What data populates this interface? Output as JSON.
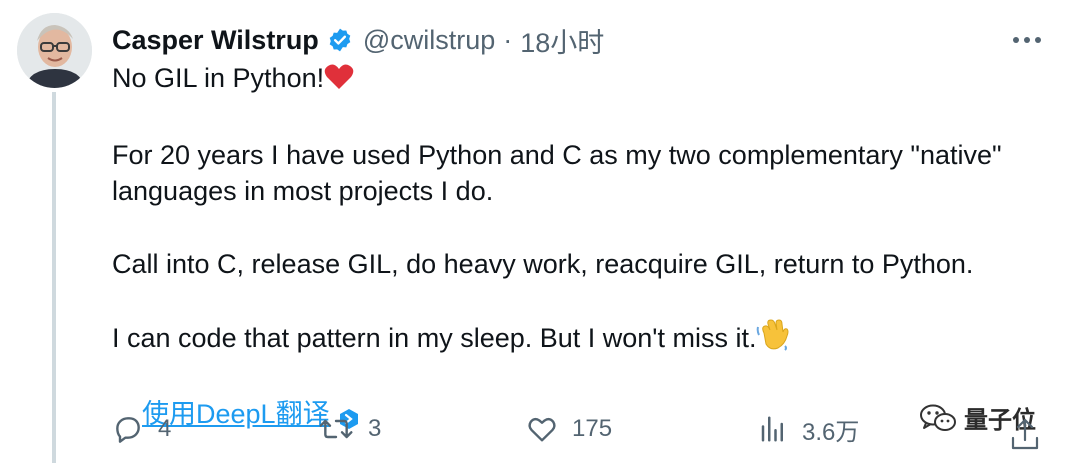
{
  "author": {
    "name": "Casper Wilstrup",
    "handle": "@cwilstrup",
    "separator": "·",
    "time": "18小时"
  },
  "tweet": {
    "lines": [
      "No GIL in Python!",
      "For 20 years I have used Python and C as my two complementary \"native\"",
      "languages in most projects I do.",
      "Call into C, release GIL, do heavy work, reacquire GIL, return to Python.",
      "I can code that pattern in my sleep. But I won't miss it."
    ],
    "translate_link": "使用DeepL翻译"
  },
  "actions": {
    "replies": "4",
    "retweets": "3",
    "likes": "175",
    "views": "3.6万"
  },
  "watermark": "量子位",
  "colors": {
    "accent": "#1d9bf0",
    "muted": "#536471",
    "thread_line": "#cfd9de"
  },
  "icons": [
    "verified-badge-icon",
    "more-icon",
    "heart-emoji-icon",
    "waving-hand-emoji-icon",
    "deepl-badge-icon",
    "reply-icon",
    "retweet-icon",
    "like-icon",
    "views-icon",
    "share-icon",
    "wechat-icon"
  ]
}
